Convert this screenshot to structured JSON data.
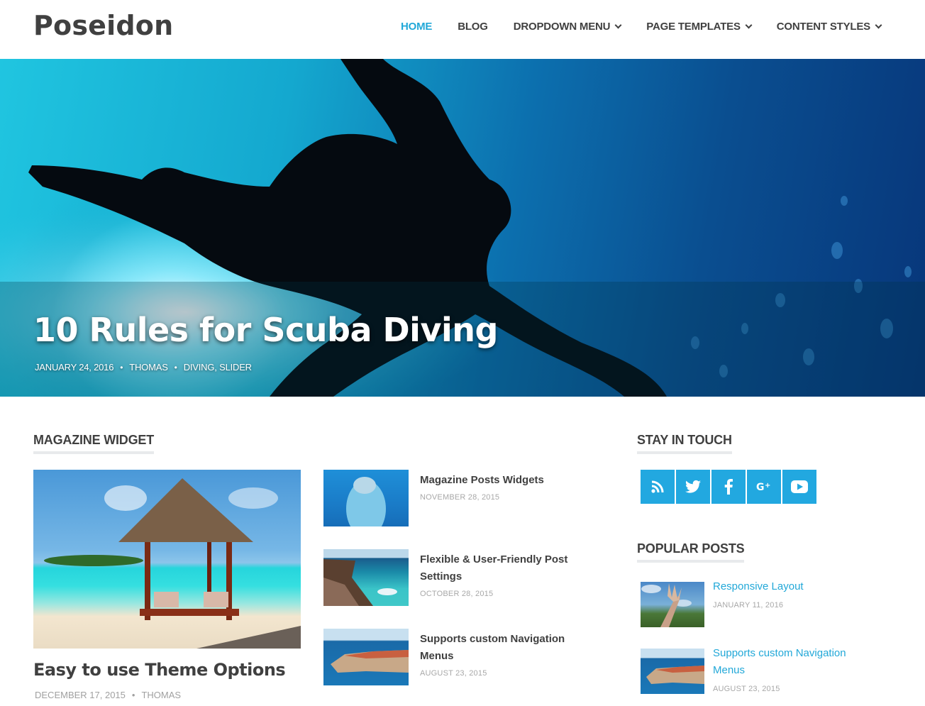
{
  "header": {
    "site_title": "Poseidon",
    "nav": [
      {
        "label": "HOME",
        "active": true,
        "has_dropdown": false
      },
      {
        "label": "BLOG",
        "active": false,
        "has_dropdown": false
      },
      {
        "label": "DROPDOWN MENU",
        "active": false,
        "has_dropdown": true
      },
      {
        "label": "PAGE TEMPLATES",
        "active": false,
        "has_dropdown": true
      },
      {
        "label": "CONTENT STYLES",
        "active": false,
        "has_dropdown": true
      }
    ]
  },
  "hero": {
    "title": "10 Rules for Scuba Diving",
    "date": "JANUARY 24, 2016",
    "author": "THOMAS",
    "categories": "DIVING, SLIDER",
    "separator": "•",
    "image": "scuba-diver-silhouette"
  },
  "magazine": {
    "heading": "MAGAZINE WIDGET",
    "featured": {
      "title": "Easy to use Theme Options",
      "date": "DECEMBER 17, 2015",
      "author": "THOMAS",
      "separator": "•",
      "image": "beach-gazebo"
    },
    "posts": [
      {
        "title": "Magazine Posts Widgets",
        "date": "NOVEMBER 28, 2015",
        "image": "dolphin"
      },
      {
        "title": "Flexible & User-Friendly Post Settings",
        "date": "OCTOBER 28, 2015",
        "image": "rocky-coast"
      },
      {
        "title": "Supports custom Navigation Menus",
        "date": "AUGUST 23, 2015",
        "image": "coastal-town"
      }
    ]
  },
  "sidebar": {
    "stay_in_touch": {
      "heading": "STAY IN TOUCH",
      "icons": [
        "rss-icon",
        "twitter-icon",
        "facebook-icon",
        "google-plus-icon",
        "youtube-icon"
      ]
    },
    "popular_posts": {
      "heading": "POPULAR POSTS",
      "items": [
        {
          "title": "Responsive Layout",
          "date": "JANUARY 11, 2016",
          "image": "trident-statue"
        },
        {
          "title": "Supports custom Navigation Menus",
          "date": "AUGUST 23, 2015",
          "image": "coastal-town"
        }
      ]
    }
  },
  "colors": {
    "accent": "#22a8d8",
    "text": "#404040",
    "meta": "#a8a8a8",
    "social_bg": "#22a8e0"
  }
}
